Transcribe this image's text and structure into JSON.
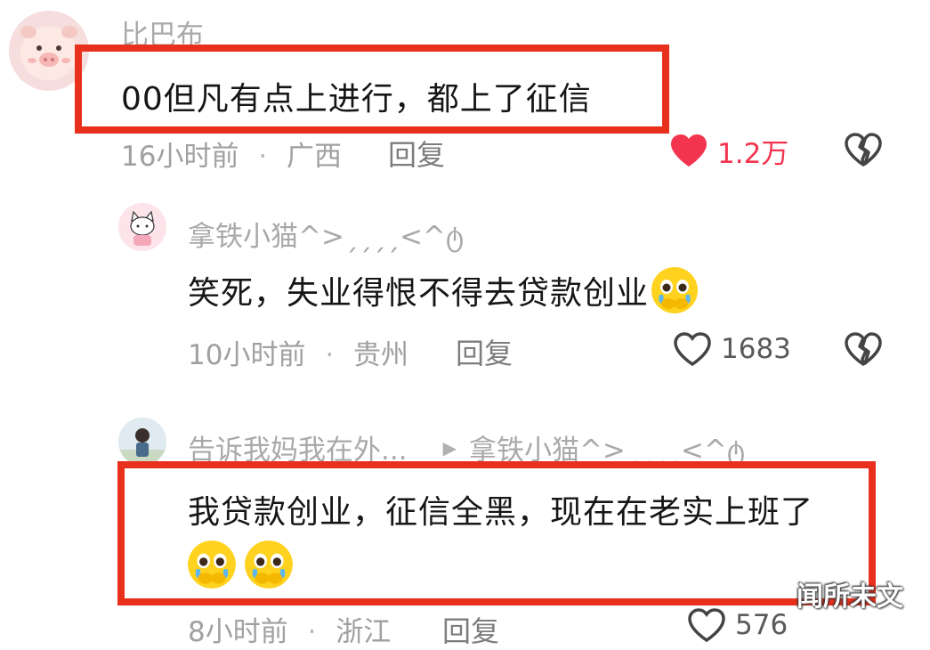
{
  "comments": [
    {
      "username": "比巴布",
      "text": "00但凡有点上进行，都上了征信",
      "time": "16小时前",
      "separator": "·",
      "location": "广西",
      "reply_label": "回复",
      "likes": "1.2万",
      "liked": true
    },
    {
      "username": "拿铁小猫^>ˏˏˏˏ<^ტ",
      "text": "笑死，失业得恨不得去贷款创业",
      "time": "10小时前",
      "separator": "·",
      "location": "贵州",
      "reply_label": "回复",
      "likes": "1683",
      "liked": false
    },
    {
      "username": "告诉我妈我在外...",
      "reply_arrow": "▶",
      "reply_to": "拿铁小猫^>ˏˏˏˏ<^ტ",
      "text": "我贷款创业，征信全黑，现在在老实上班了",
      "time": "8小时前",
      "separator": "·",
      "location": "浙江",
      "reply_label": "回复",
      "likes": "576",
      "liked": false
    }
  ],
  "watermark": "闻所未文",
  "colors": {
    "highlight": "#e8301c",
    "like_active": "#f2344f",
    "muted": "#a9a9a9"
  },
  "icons": {
    "like": "heart-icon",
    "dislike": "broken-heart-icon",
    "emoji": "pleading-face-emoji"
  }
}
